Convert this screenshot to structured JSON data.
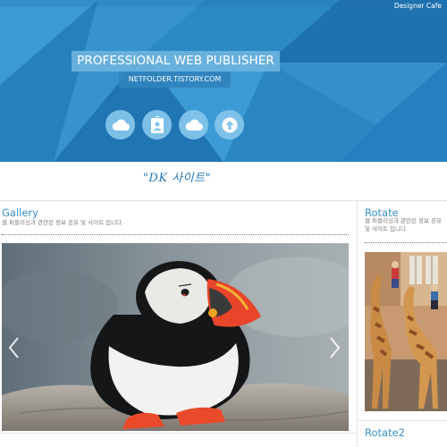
{
  "header": {
    "brand": "Designer Cafe",
    "title": "PROFESSIONAL WEB PUBLISHER",
    "url": "NETFOLDER.TISTORY.COM",
    "icons": [
      "cloud-icon",
      "id-badge-icon",
      "cloud-icon",
      "upload-arrow-icon"
    ],
    "colors": {
      "banner": "#2b8ac3",
      "title_bg": "#6cb2de",
      "icon_bg": "#82c4eb"
    }
  },
  "tagline": "\"DK 사이트\"",
  "gallery": {
    "title": "Gallery",
    "description": "웹 퍼블리싱과 관련된 정보 공유 및 사이트 입니다.",
    "prev_icon": "chevron-left-icon",
    "next_icon": "chevron-right-icon"
  },
  "rotate": {
    "title": "Rotate",
    "description": "웹 퍼블리싱과 관련된 정보 공유 및 사이트 입니다."
  },
  "rotate2": {
    "title": "Rotate2"
  },
  "accent_color": "#3a8fc8"
}
